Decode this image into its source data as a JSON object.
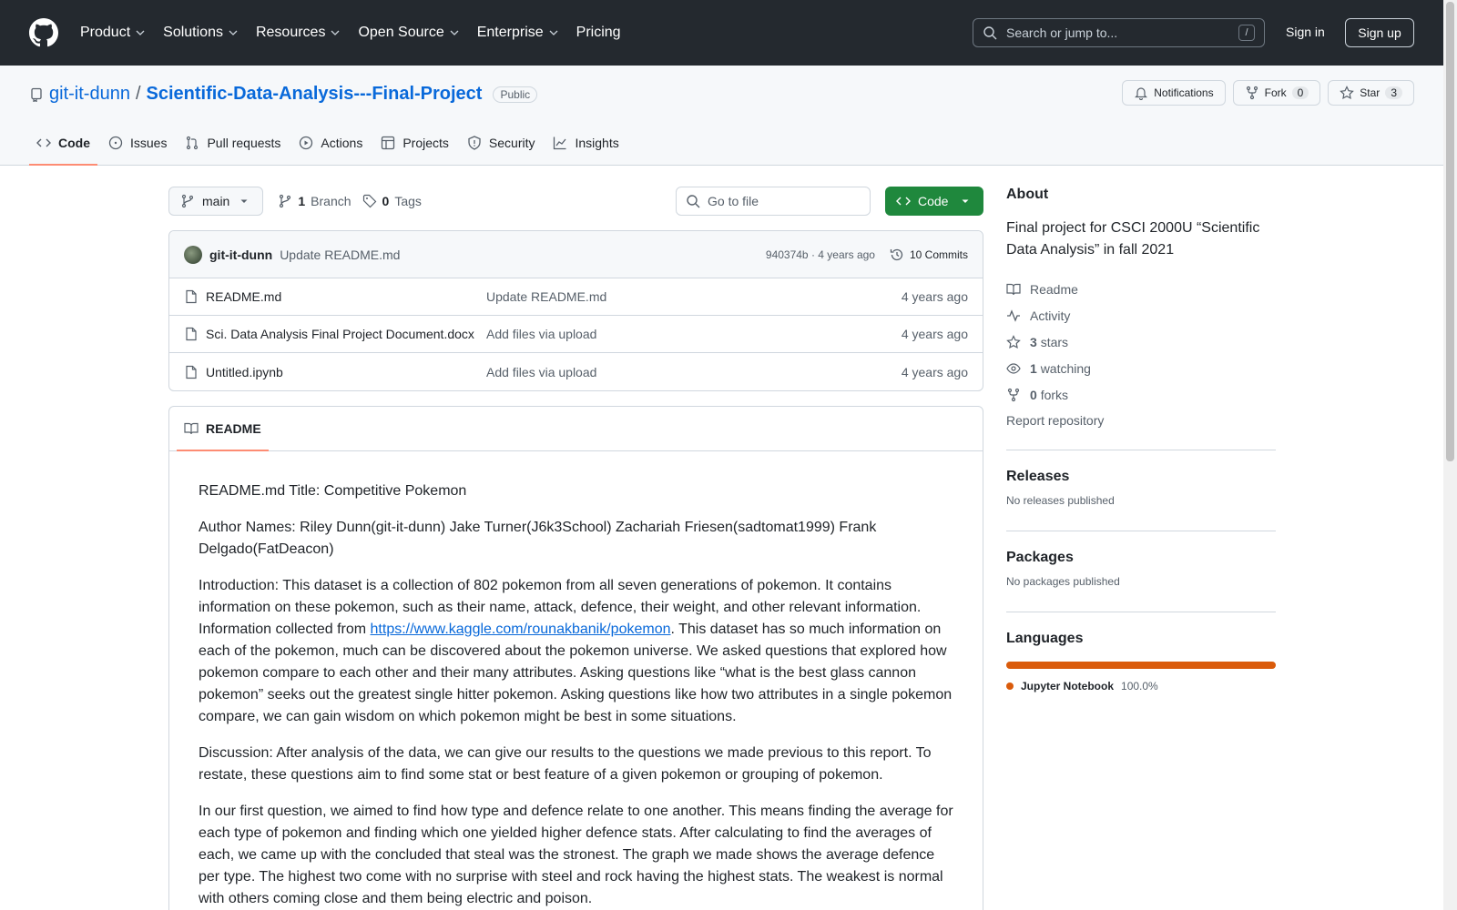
{
  "header": {
    "nav": [
      "Product",
      "Solutions",
      "Resources",
      "Open Source",
      "Enterprise",
      "Pricing"
    ],
    "search_placeholder": "Search or jump to...",
    "search_key": "/",
    "signin": "Sign in",
    "signup": "Sign up"
  },
  "repo": {
    "owner": "git-it-dunn",
    "separator": "/",
    "name": "Scientific-Data-Analysis---Final-Project",
    "visibility": "Public",
    "notifications": "Notifications",
    "fork": "Fork",
    "fork_count": "0",
    "star": "Star",
    "star_count": "3"
  },
  "tabs": [
    "Code",
    "Issues",
    "Pull requests",
    "Actions",
    "Projects",
    "Security",
    "Insights"
  ],
  "toolbar": {
    "branch": "main",
    "branch_count": "1",
    "branch_label": "Branch",
    "tag_count": "0",
    "tag_label": "Tags",
    "goto_placeholder": "Go to file",
    "code_button": "Code"
  },
  "commit": {
    "author": "git-it-dunn",
    "message": "Update README.md",
    "sha_age": "940374b · 4 years ago",
    "commits": "10 Commits"
  },
  "files": [
    {
      "name": "README.md",
      "message": "Update README.md",
      "age": "4 years ago"
    },
    {
      "name": "Sci. Data Analysis Final Project Document.docx",
      "message": "Add files via upload",
      "age": "4 years ago"
    },
    {
      "name": "Untitled.ipynb",
      "message": "Add files via upload",
      "age": "4 years ago"
    }
  ],
  "readme": {
    "tab": "README",
    "p1": "README.md Title: Competitive Pokemon",
    "p2": "Author Names: Riley Dunn(git-it-dunn) Jake Turner(J6k3School) Zachariah Friesen(sadtomat1999) Frank Delgado(FatDeacon)",
    "p3a": "Introduction: This dataset is a collection of 802 pokemon from all seven generations of pokemon. It contains information on these pokemon, such as their name, attack, defence, their weight, and other relevant information. Information collected from ",
    "p3link": "https://www.kaggle.com/rounakbanik/pokemon",
    "p3b": ". This dataset has so much information on each of the pokemon, much can be discovered about the pokemon universe. We asked questions that explored how pokemon compare to each other and their many attributes. Asking questions like “what is the best glass cannon pokemon” seeks out the greatest single hitter pokemon. Asking questions like how two attributes in a single pokemon compare, we can gain wisdom on which pokemon might be best in some situations.",
    "p4": "Discussion: After analysis of the data, we can give our results to the questions we made previous to this report. To restate, these questions aim to find some stat or best feature of a given pokemon or grouping of pokemon.",
    "p5": "In our first question, we aimed to find how type and defence relate to one another. This means finding the average for each type of pokemon and finding which one yielded higher defence stats. After calculating to find the averages of each, we came up with the concluded that steal was the stronest. The graph we made shows the average defence per type. The highest two come with no surprise with steel and rock having the highest stats. The weakest is normal with others coming close and them being electric and poison."
  },
  "sidebar": {
    "about_title": "About",
    "about_text": "Final project for CSCI 2000U “Scientific Data Analysis” in fall 2021",
    "readme": "Readme",
    "activity": "Activity",
    "stars_count": "3",
    "stars_label": "stars",
    "watching_count": "1",
    "watching_label": "watching",
    "forks_count": "0",
    "forks_label": "forks",
    "report": "Report repository",
    "releases_title": "Releases",
    "releases_text": "No releases published",
    "packages_title": "Packages",
    "packages_text": "No packages published",
    "languages_title": "Languages",
    "language_name": "Jupyter Notebook",
    "language_pct": "100.0%",
    "language_fraction": 1.0,
    "language_color": "#DA5B0B"
  }
}
